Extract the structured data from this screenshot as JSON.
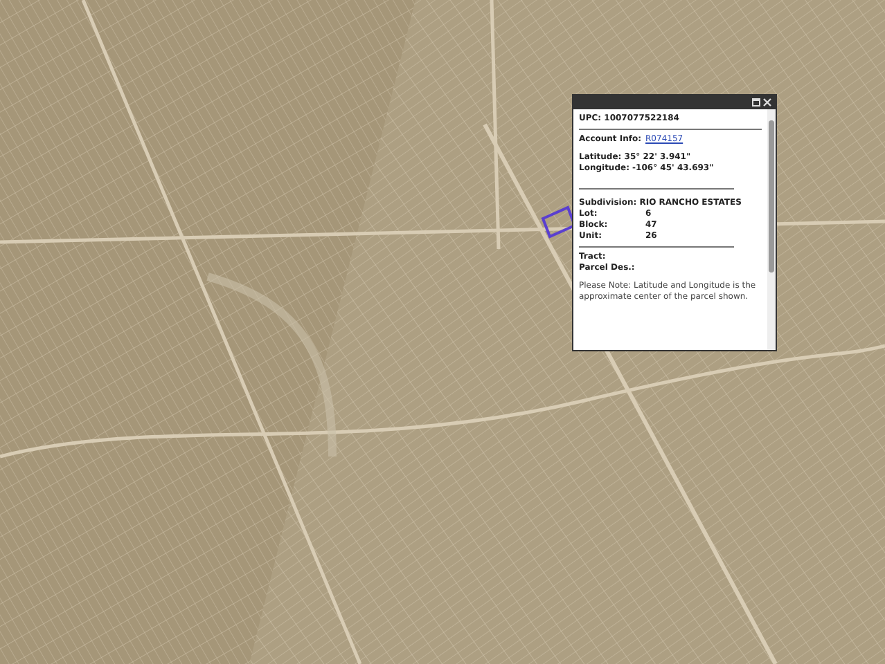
{
  "popup": {
    "upc": "UPC: 1007077522184",
    "account": {
      "label": "Account Info:",
      "link": "R074157"
    },
    "coordinates": [
      "Latitude: 35° 22' 3.941\"",
      "Longitude: -106° 45' 43.693\""
    ],
    "subdivision": {
      "label": "Subdivision:",
      "value": "RIO RANCHO ESTATES"
    },
    "parcel_fields": [
      {
        "label": "Lot:",
        "value": "6"
      },
      {
        "label": "Block:",
        "value": "47"
      },
      {
        "label": "Unit:",
        "value": "26"
      }
    ],
    "extra_fields": [
      "Tract:",
      "Parcel Des.:"
    ],
    "note": "Please Note: Latitude and Longitude is the approximate center of the parcel shown."
  }
}
